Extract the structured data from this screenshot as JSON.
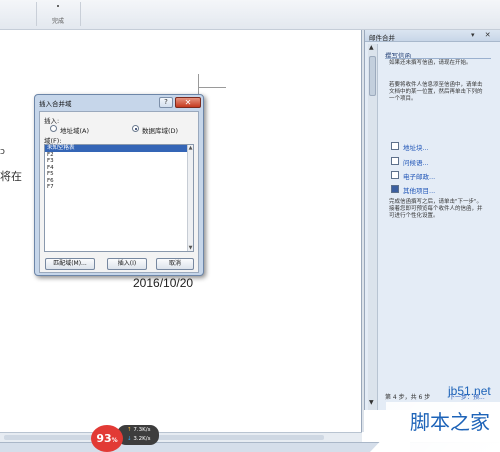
{
  "ribbon": {
    "finish_label": "完成"
  },
  "document": {
    "fragment_1": "ɔ",
    "fragment_2": "将在",
    "date_text": "2016/10/20"
  },
  "dialog": {
    "title": "插入合并域",
    "help_label": "?",
    "close_label": "✕",
    "insert_label": "插入:",
    "radio_address": "地址域(A)",
    "radio_database": "数据库域(D)",
    "fields_label": "域(F):",
    "fields": [
      "未知空格表",
      "F2",
      "F3",
      "F4",
      "F5",
      "F6",
      "F7"
    ],
    "selected_index": 0,
    "match_button": "匹配域(M)...",
    "insert_button": "插入(I)",
    "cancel_button": "取消"
  },
  "pane": {
    "title": "邮件合并",
    "controls": "▾ ✕",
    "section": "撰写信函",
    "text_1": "如果还未撰写信函，请现在开始。",
    "text_2": "若要将收件人信息添至信函中，请单击文档中的某一位置，然后再单击下列的一个项目。",
    "link_address": "地址块...",
    "link_greeting": "问候语...",
    "link_postage": "电子邮政...",
    "link_other": "其他项目...",
    "text_3": "完成信函撰写之后，请单击\"下一步\"。接着您即可预览每个收件人的信函，并可进行个性化设置。",
    "step_text": "第 4 步，共 6 步",
    "next_text": "下一步：预..."
  },
  "speed_badge": {
    "percent": "93",
    "percent_unit": "%",
    "upload": "7.3K/s",
    "download": "3.2K/s"
  },
  "watermark": {
    "site": "jb51.net",
    "brand": "脚本之家"
  },
  "colors": {
    "accent": "#1f55b7",
    "selection": "#3465b6",
    "badge_red": "#e23a35",
    "close_red": "#c5391e"
  }
}
